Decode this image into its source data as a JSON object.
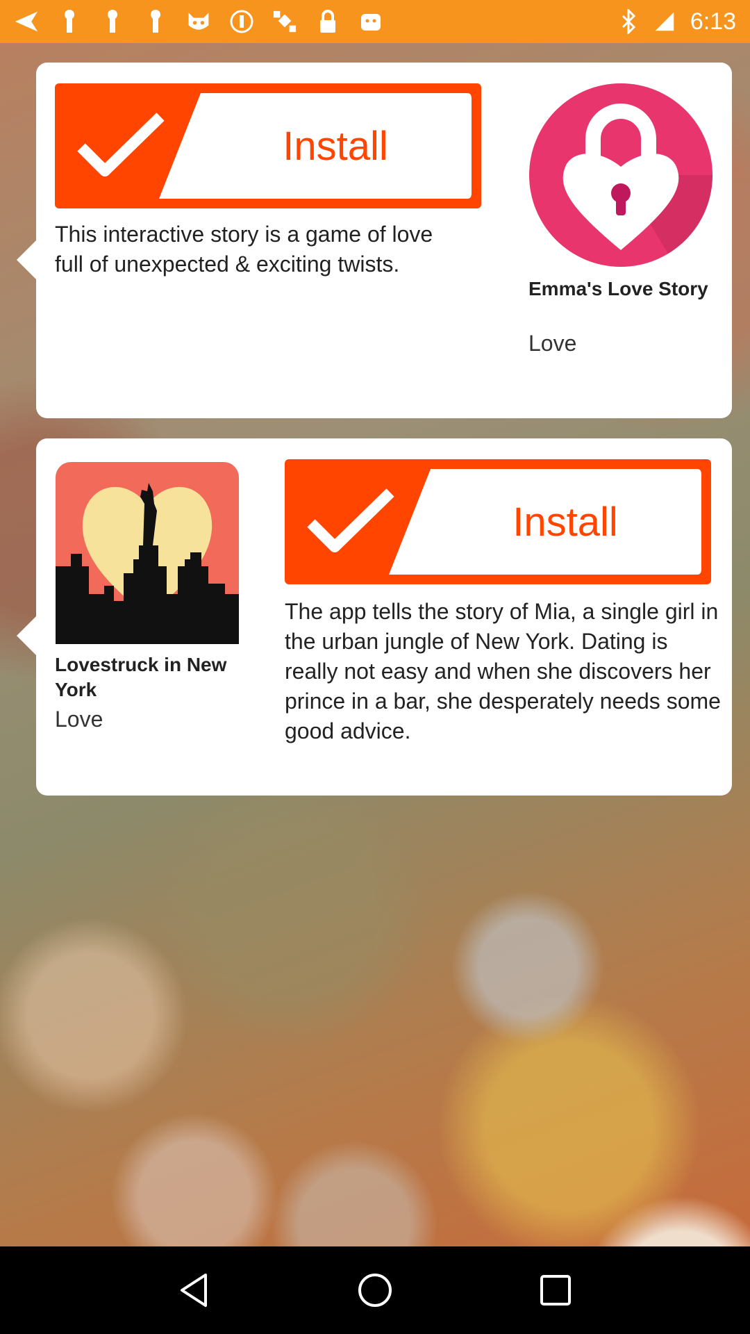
{
  "status_bar": {
    "time": "6:13",
    "bg_color": "#f7941d",
    "icons": [
      "navigation-icon",
      "notification-icon",
      "notification-icon",
      "cat-icon",
      "alert-icon",
      "satellite-icon",
      "lock-icon",
      "android-icon",
      "bluetooth-icon",
      "signal-icon"
    ]
  },
  "cards": [
    {
      "install_label": "Install",
      "description": "This interactive story is a game of love full of unexpected & exciting twists.",
      "app_title": "Emma's Love Story",
      "app_category": "Love",
      "icon": "heart-lock-icon"
    },
    {
      "install_label": "Install",
      "description": "The app tells the story of Mia, a single girl in the urban jungle of New York. Dating is really not easy and when she discovers her prince in a bar, she desperately needs some good advice.",
      "app_title": "Lovestruck in New York",
      "app_category": "Love",
      "icon": "statue-of-liberty-heart-icon"
    }
  ],
  "colors": {
    "accent": "#ff4500",
    "lock_pink": "#e8356d"
  },
  "nav": [
    "back-icon",
    "home-icon",
    "recents-icon"
  ]
}
